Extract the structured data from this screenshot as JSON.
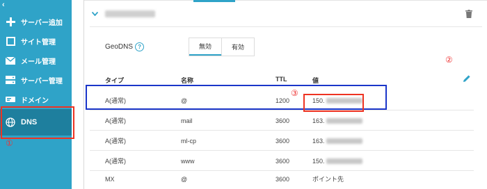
{
  "sidebar": {
    "back_glyph": "‹",
    "items": [
      {
        "label": "サーバー追加",
        "icon": "plus-icon"
      },
      {
        "label": "サイト管理",
        "icon": "window-icon"
      },
      {
        "label": "メール管理",
        "icon": "envelope-icon"
      },
      {
        "label": "サーバー管理",
        "icon": "server-icon"
      },
      {
        "label": "ドメイン",
        "icon": "domain-icon"
      },
      {
        "label": "DNS",
        "icon": "globe-icon",
        "active": true
      }
    ]
  },
  "panel": {
    "geodns_label": "GeoDNS",
    "help_glyph": "?",
    "geodns_options": [
      "無効",
      "有効"
    ],
    "geodns_selected": "無効"
  },
  "table": {
    "headers": {
      "type": "タイプ",
      "name": "名称",
      "ttl": "TTL",
      "value": "値"
    },
    "rows": [
      {
        "type": "A(通常)",
        "name": "@",
        "ttl": "1200",
        "value": "150."
      },
      {
        "type": "A(通常)",
        "name": "mail",
        "ttl": "3600",
        "value": "163."
      },
      {
        "type": "A(通常)",
        "name": "ml-cp",
        "ttl": "3600",
        "value": "163."
      },
      {
        "type": "A(通常)",
        "name": "www",
        "ttl": "3600",
        "value": "150."
      },
      {
        "type": "MX",
        "name": "@",
        "ttl": "3600",
        "value": "ポイント先"
      }
    ]
  },
  "annotations": {
    "one": "①",
    "two": "②",
    "three": "③"
  },
  "colors": {
    "sidebar": "#2fa3c8",
    "sidebar_active": "#1e7f9e",
    "highlight_blue": "#1a35c9",
    "highlight_red": "#e33333",
    "accent": "#2fa3c8"
  }
}
